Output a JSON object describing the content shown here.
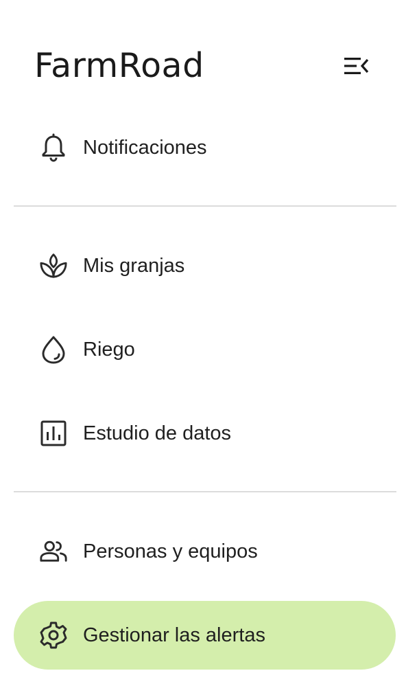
{
  "app": {
    "brand": "FarmRoad"
  },
  "nav": {
    "notifications": {
      "label": "Notificaciones",
      "icon": "bell-icon"
    },
    "farms": {
      "label": "Mis granjas",
      "icon": "sprout-icon"
    },
    "irrigation": {
      "label": "Riego",
      "icon": "water-drop-icon"
    },
    "data_study": {
      "label": "Estudio de datos",
      "icon": "bar-chart-icon"
    },
    "people_teams": {
      "label": "Personas y equipos",
      "icon": "people-icon"
    },
    "manage_alerts": {
      "label": "Gestionar las alertas",
      "icon": "gear-icon",
      "active": true
    }
  },
  "colors": {
    "active_background": "#d4eeac",
    "divider": "#dcdcdc",
    "text": "#1f1f1f"
  }
}
